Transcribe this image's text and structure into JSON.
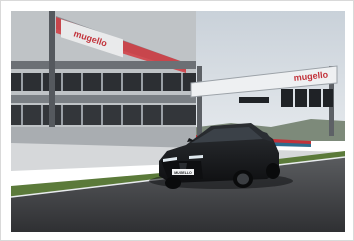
{
  "photo": {
    "sign_left_text": "mugello",
    "gantry_text": "mugello",
    "plate_text": "MUGELLO"
  },
  "colors": {
    "sky": "#d7dde3",
    "track": "#4a4c4f",
    "grass": "#5b7a3a",
    "car": "#1a1c1f",
    "headlight": "#dfe8ee",
    "accent_red": "#c2323a"
  }
}
